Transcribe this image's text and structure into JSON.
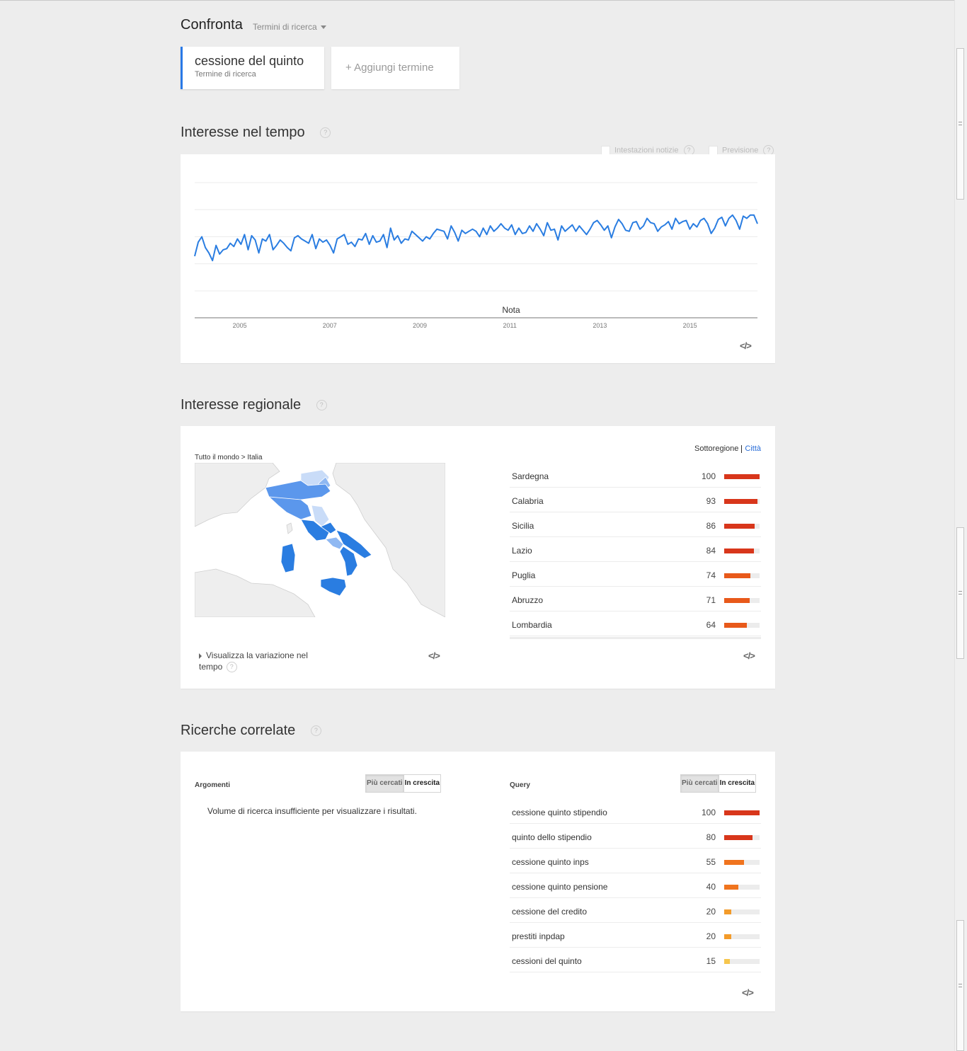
{
  "compare": {
    "title": "Confronta",
    "term_type_label": "Termini di ricerca",
    "term": {
      "name": "cessione del quinto",
      "type": "Termine di ricerca",
      "color": "#2979e6"
    },
    "add_term_label": "+ Aggiungi termine"
  },
  "interest_time": {
    "title": "Interesse nel tempo",
    "help": "?",
    "options": [
      {
        "label": "Intestazioni notizie",
        "checked": false
      },
      {
        "label": "Previsione",
        "checked": false
      }
    ],
    "note_label": "Nota",
    "embed_label": "</>",
    "chart_data": {
      "type": "line",
      "title": "",
      "xlabel": "",
      "ylabel": "",
      "x_tick_labels": [
        "2005",
        "2007",
        "2009",
        "2011",
        "2013",
        "2015"
      ],
      "x_range": [
        "2004-01",
        "2016-06"
      ],
      "ylim": [
        0,
        100
      ],
      "grid": true,
      "series": [
        {
          "color": "#2a7de1",
          "values": [
            32,
            45,
            50,
            40,
            35,
            28,
            42,
            34,
            38,
            39,
            44,
            41,
            48,
            43,
            52,
            38,
            51,
            47,
            35,
            48,
            46,
            52,
            38,
            42,
            47,
            44,
            40,
            37,
            49,
            51,
            48,
            46,
            44,
            52,
            39,
            48,
            45,
            47,
            42,
            35,
            48,
            50,
            52,
            43,
            45,
            41,
            48,
            47,
            53,
            43,
            51,
            45,
            46,
            52,
            40,
            58,
            47,
            51,
            44,
            48,
            47,
            55,
            52,
            49,
            46,
            50,
            48,
            53,
            57,
            56,
            55,
            48,
            60,
            54,
            46,
            56,
            53,
            55,
            57,
            55,
            50,
            58,
            52,
            60,
            55,
            58,
            62,
            58,
            56,
            61,
            52,
            58,
            53,
            54,
            60,
            55,
            62,
            57,
            51,
            63,
            56,
            57,
            47,
            60,
            55,
            58,
            61,
            55,
            60,
            56,
            52,
            57,
            63,
            65,
            61,
            56,
            60,
            49,
            59,
            66,
            62,
            56,
            55,
            63,
            64,
            57,
            60,
            67,
            63,
            62,
            55,
            59,
            61,
            64,
            57,
            67,
            62,
            64,
            65,
            57,
            62,
            59,
            65,
            67,
            62,
            53,
            58,
            66,
            68,
            60,
            67,
            70,
            65,
            57,
            69,
            67,
            70,
            70,
            62
          ]
        }
      ]
    }
  },
  "regional": {
    "title": "Interesse regionale",
    "help": "?",
    "breadcrumb": "Tutto il mondo > Italia",
    "toggle": {
      "subregion": "Sottoregione",
      "city": "Città"
    },
    "show_change_label": "Visualizza la variazione nel tempo",
    "embed_label": "</>",
    "map_colors": {
      "high": "#2a7de1",
      "mid": "#5b97ec",
      "low": "#8fb8f2",
      "lowest": "#c9dcf8"
    },
    "rows": [
      {
        "name": "Sardegna",
        "value": 100,
        "color": "#d8361b"
      },
      {
        "name": "Calabria",
        "value": 93,
        "color": "#d8361b"
      },
      {
        "name": "Sicilia",
        "value": 86,
        "color": "#d8361b"
      },
      {
        "name": "Lazio",
        "value": 84,
        "color": "#d8361b"
      },
      {
        "name": "Puglia",
        "value": 74,
        "color": "#e8591a"
      },
      {
        "name": "Abruzzo",
        "value": 71,
        "color": "#e8591a"
      },
      {
        "name": "Lombardia",
        "value": 64,
        "color": "#e8591a"
      }
    ]
  },
  "related": {
    "title": "Ricerche correlate",
    "help": "?",
    "topics": {
      "label": "Argomenti",
      "btn_top": "Più cercati",
      "btn_rising": "In crescita",
      "message": "Volume di ricerca insufficiente per visualizzare i risultati."
    },
    "queries": {
      "label": "Query",
      "btn_top": "Più cercati",
      "btn_rising": "In crescita",
      "embed_label": "</>",
      "rows": [
        {
          "name": "cessione quinto stipendio",
          "value": 100,
          "color": "#d8361b"
        },
        {
          "name": "quinto dello stipendio",
          "value": 80,
          "color": "#d8361b"
        },
        {
          "name": "cessione quinto inps",
          "value": 55,
          "color": "#f0741e"
        },
        {
          "name": "cessione quinto pensione",
          "value": 40,
          "color": "#f0741e"
        },
        {
          "name": "cessione del credito",
          "value": 20,
          "color": "#f39b2a"
        },
        {
          "name": "prestiti inpdap",
          "value": 20,
          "color": "#f39b2a"
        },
        {
          "name": "cessioni del quinto",
          "value": 15,
          "color": "#f6c64d"
        }
      ]
    }
  }
}
